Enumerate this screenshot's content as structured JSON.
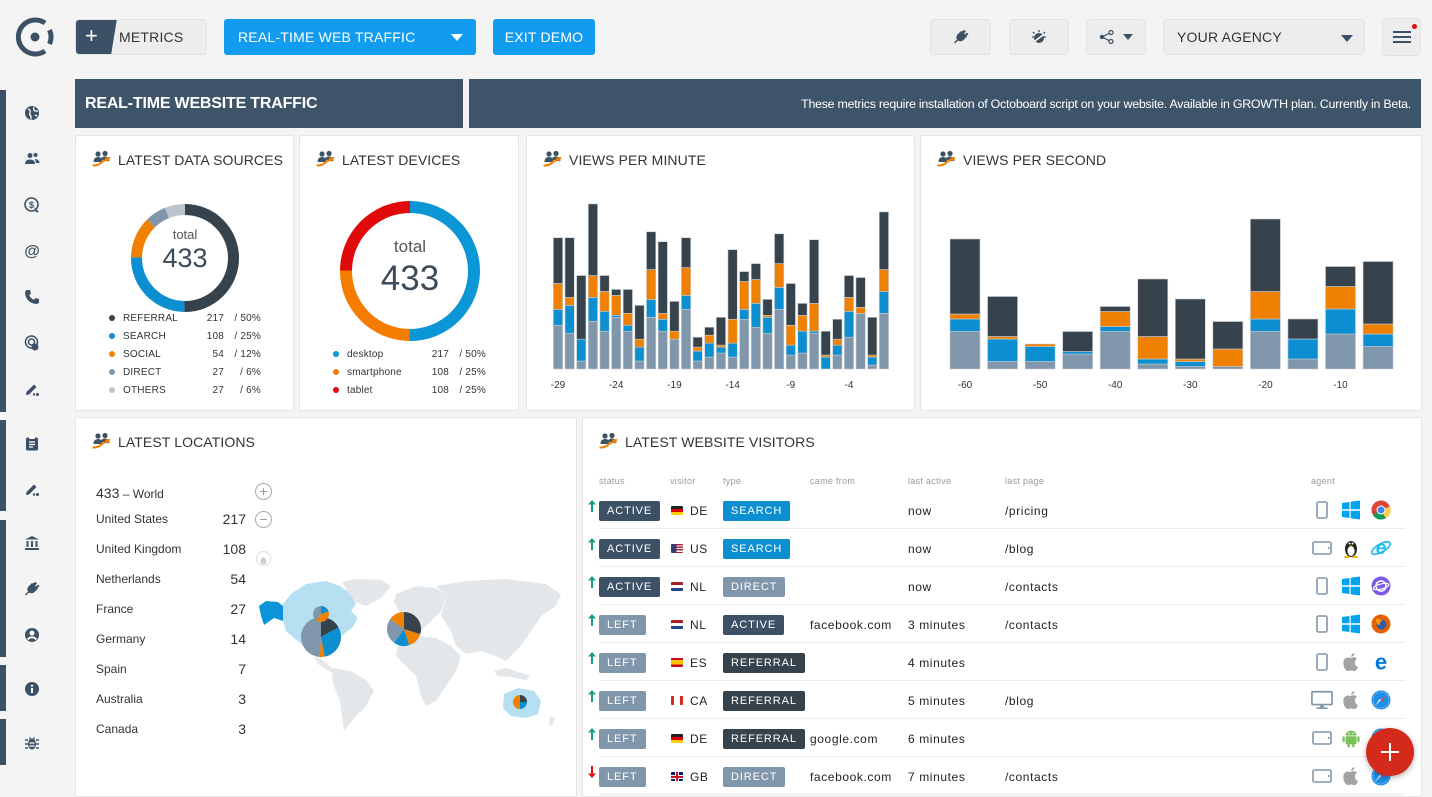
{
  "toolbar": {
    "metrics_label": "METRICS",
    "add_icon": "+",
    "dashboard_select": "REAL-TIME WEB TRAFFIC",
    "exit_demo": "EXIT DEMO",
    "agency_select": "YOUR AGENCY",
    "icons": [
      "plug-icon",
      "idea-icon",
      "share-icon",
      "menu-icon"
    ],
    "notification_dot_color": "#e01010"
  },
  "sidebar": {
    "groups": [
      [
        "globe-icon",
        "users-icon",
        "revenue-icon",
        "email-icon",
        "phone-icon",
        "fingerprint-icon",
        "edit-icon"
      ],
      [
        "clipboard-icon",
        "edit-icon"
      ],
      [
        "bank-icon",
        "plug-icon",
        "user-icon"
      ],
      [
        "info-icon"
      ],
      [
        "bug-icon"
      ]
    ]
  },
  "banner": {
    "title": "REAL-TIME WEBSITE TRAFFIC",
    "notice": "These metrics require installation of Octoboard script on your website. Available in GROWTH plan. Currently in Beta."
  },
  "colors": {
    "slate": "#3d5166",
    "referral": "#36424c",
    "search": "#0b8fd0",
    "social": "#f08000",
    "direct": "#8096ab",
    "others": "#bcc5cd",
    "tablet": "#e00a0a",
    "accent_blue": "#129cf0",
    "fab_red": "#d42a1c"
  },
  "chart_data": [
    {
      "id": "data_sources",
      "type": "pie",
      "title": "LATEST DATA SOURCES",
      "center_label": "total",
      "total": 433,
      "slices": [
        {
          "label": "REFERRAL",
          "value": 217,
          "percent": "50%",
          "color": "#36424c"
        },
        {
          "label": "SEARCH",
          "value": 108,
          "percent": "25%",
          "color": "#0b8fd0"
        },
        {
          "label": "SOCIAL",
          "value": 54,
          "percent": "12%",
          "color": "#f08000"
        },
        {
          "label": "DIRECT",
          "value": 27,
          "percent": "6%",
          "color": "#8096ab"
        },
        {
          "label": "OTHERS",
          "value": 27,
          "percent": "6%",
          "color": "#bcc5cd"
        }
      ]
    },
    {
      "id": "devices",
      "type": "pie",
      "title": "LATEST DEVICES",
      "center_label": "total",
      "total": 433,
      "slices": [
        {
          "label": "desktop",
          "value": 217,
          "percent": "50%",
          "color": "#0b97d6"
        },
        {
          "label": "smartphone",
          "value": 108,
          "percent": "25%",
          "color": "#f57c00"
        },
        {
          "label": "tablet",
          "value": 108,
          "percent": "25%",
          "color": "#e00a0a"
        }
      ]
    },
    {
      "id": "views_per_minute",
      "type": "bar",
      "stacked": true,
      "title": "VIEWS PER MINUTE",
      "xlabel": "",
      "ylabel": "",
      "categories": [
        -29,
        -28,
        -27,
        -26,
        -25,
        -24,
        -23,
        -22,
        -21,
        -20,
        -19,
        -18,
        -17,
        -16,
        -15,
        -14,
        -13,
        -12,
        -11,
        -10,
        -9,
        -8,
        -7,
        -6,
        -5,
        -4,
        -3,
        -2,
        -1
      ],
      "tick_labels": [
        "-29",
        "-24",
        "-19",
        "-14",
        "-9",
        "-4"
      ],
      "ylim": [
        0,
        88
      ],
      "grid": false,
      "series": [
        {
          "name": "DIRECT",
          "color": "#8096ab",
          "values": [
            22,
            18,
            4,
            24,
            19,
            26,
            19,
            4,
            26,
            19,
            15,
            30,
            4,
            6,
            8,
            6,
            25,
            21,
            18,
            30,
            7,
            8,
            18,
            0,
            7,
            16,
            28,
            2,
            28
          ]
        },
        {
          "name": "SEARCH",
          "color": "#0b8fd0",
          "values": [
            8,
            14,
            11,
            12,
            10,
            1,
            3,
            7,
            9,
            6,
            0,
            7,
            5,
            7,
            3,
            7,
            5,
            12,
            8,
            11,
            5,
            11,
            1,
            6,
            5,
            13,
            0,
            4,
            11
          ]
        },
        {
          "name": "SOCIAL",
          "color": "#f08000",
          "values": [
            13,
            4,
            0,
            11,
            10,
            10,
            6,
            4,
            15,
            3,
            4,
            14,
            2,
            4,
            1,
            12,
            14,
            12,
            1,
            12,
            10,
            8,
            14,
            1,
            3,
            7,
            3,
            1,
            11
          ]
        },
        {
          "name": "REFERRAL",
          "color": "#36424c",
          "values": [
            23,
            30,
            32,
            36,
            8,
            3,
            12,
            17,
            19,
            36,
            15,
            15,
            5,
            4,
            14,
            35,
            5,
            8,
            8,
            15,
            21,
            6,
            32,
            12,
            10,
            11,
            15,
            19,
            29
          ]
        }
      ]
    },
    {
      "id": "views_per_second",
      "type": "bar",
      "stacked": true,
      "title": "VIEWS PER SECOND",
      "xlabel": "",
      "ylabel": "",
      "categories": [
        -60,
        -55,
        -50,
        -45,
        -40,
        -35,
        -30,
        -25,
        -20,
        -15,
        -10,
        -5
      ],
      "tick_labels": [
        "-60",
        "-50",
        "-40",
        "-30",
        "-20",
        "-10"
      ],
      "ylim": [
        0,
        64
      ],
      "grid": false,
      "series": [
        {
          "name": "DIRECT",
          "color": "#8096ab",
          "values": [
            15,
            3,
            3,
            6,
            15,
            2,
            1,
            1,
            15,
            4,
            14,
            9
          ]
        },
        {
          "name": "SEARCH",
          "color": "#0b8fd0",
          "values": [
            5,
            9,
            6,
            1,
            2,
            2,
            2,
            0,
            5,
            8,
            10,
            5
          ]
        },
        {
          "name": "SOCIAL",
          "color": "#f08000",
          "values": [
            2,
            1,
            1,
            0,
            6,
            9,
            1,
            7,
            11,
            0,
            9,
            4
          ]
        },
        {
          "name": "REFERRAL",
          "color": "#36424c",
          "values": [
            30,
            16,
            0,
            8,
            2,
            23,
            24,
            11,
            29,
            8,
            8,
            25
          ]
        }
      ]
    }
  ],
  "locations": {
    "title": "LATEST LOCATIONS",
    "world_total": "433",
    "world_label": "– World",
    "rows": [
      {
        "country": "United States",
        "value": "217"
      },
      {
        "country": "United Kingdom",
        "value": "108"
      },
      {
        "country": "Netherlands",
        "value": "54"
      },
      {
        "country": "France",
        "value": "27"
      },
      {
        "country": "Germany",
        "value": "14"
      },
      {
        "country": "Spain",
        "value": "7"
      },
      {
        "country": "Australia",
        "value": "3"
      },
      {
        "country": "Canada",
        "value": "3"
      }
    ],
    "zoom_controls": {
      "zoom_in": "+",
      "zoom_out": "−"
    },
    "map_markers": [
      {
        "region": "United States",
        "slices": [
          {
            "series": "REFERRAL",
            "share": 0.17
          },
          {
            "series": "SEARCH",
            "share": 0.3
          },
          {
            "series": "SOCIAL",
            "share": 0.04
          },
          {
            "series": "DIRECT",
            "share": 0.49
          }
        ]
      },
      {
        "region": "Canada",
        "slices": [
          {
            "series": "SEARCH",
            "share": 0.2
          },
          {
            "series": "SOCIAL",
            "share": 0.4
          },
          {
            "series": "DIRECT",
            "share": 0.4
          }
        ]
      },
      {
        "region": "Europe",
        "slices": [
          {
            "series": "REFERRAL",
            "share": 0.3
          },
          {
            "series": "SOCIAL",
            "share": 0.15
          },
          {
            "series": "SEARCH",
            "share": 0.15
          },
          {
            "series": "DIRECT",
            "share": 0.25
          },
          {
            "series": "SOCIAL",
            "share": 0.15
          }
        ]
      },
      {
        "region": "Australia",
        "slices": [
          {
            "series": "REFERRAL",
            "share": 0.25
          },
          {
            "series": "SEARCH",
            "share": 0.25
          },
          {
            "series": "SOCIAL",
            "share": 0.5
          }
        ]
      }
    ]
  },
  "visitors": {
    "title": "LATEST WEBSITE VISITORS",
    "columns": {
      "status": "status",
      "visitor": "visitor",
      "type": "type",
      "came_from": "came from",
      "last_active": "last active",
      "last_page": "last page",
      "agent": "agent"
    },
    "badge_colors": {
      "ACTIVE": "#3d5166",
      "LEFT": "#8096ab",
      "SEARCH": "#0b8fd0",
      "DIRECT": "#8096ab",
      "REFERRAL": "#36424c"
    },
    "rows": [
      {
        "trend": "up",
        "status": "ACTIVE",
        "country": "DE",
        "type": "SEARCH",
        "came_from": "",
        "last_active": "now",
        "last_page": "/pricing",
        "device": "phone",
        "os": "windows",
        "browser": "chrome"
      },
      {
        "trend": "up",
        "status": "ACTIVE",
        "country": "US",
        "type": "SEARCH",
        "came_from": "",
        "last_active": "now",
        "last_page": "/blog",
        "device": "tablet",
        "os": "linux",
        "browser": "ie"
      },
      {
        "trend": "up",
        "status": "ACTIVE",
        "country": "NL",
        "type": "DIRECT",
        "came_from": "",
        "last_active": "now",
        "last_page": "/contacts",
        "device": "phone",
        "os": "windows",
        "browser": "samsung"
      },
      {
        "trend": "up",
        "status": "LEFT",
        "country": "NL",
        "type": "ACTIVE",
        "came_from": "facebook.com",
        "last_active": "3 minutes",
        "last_page": "/contacts",
        "device": "phone",
        "os": "windows",
        "browser": "firefox"
      },
      {
        "trend": "up",
        "status": "LEFT",
        "country": "ES",
        "type": "REFERRAL",
        "came_from": "",
        "last_active": "4 minutes",
        "last_page": "",
        "device": "phone",
        "os": "apple",
        "browser": "edge"
      },
      {
        "trend": "up",
        "status": "LEFT",
        "country": "CA",
        "type": "REFERRAL",
        "came_from": "",
        "last_active": "5 minutes",
        "last_page": "/blog",
        "device": "desktop",
        "os": "apple",
        "browser": "safari"
      },
      {
        "trend": "up",
        "status": "LEFT",
        "country": "DE",
        "type": "REFERRAL",
        "came_from": "google.com",
        "last_active": "6 minutes",
        "last_page": "",
        "device": "tablet",
        "os": "android",
        "browser": "safari"
      },
      {
        "trend": "down",
        "status": "LEFT",
        "country": "GB",
        "type": "DIRECT",
        "came_from": "facebook.com",
        "last_active": "7 minutes",
        "last_page": "/contacts",
        "device": "tablet",
        "os": "apple",
        "browser": "safari"
      }
    ]
  },
  "fab": {
    "icon": "add-icon"
  }
}
